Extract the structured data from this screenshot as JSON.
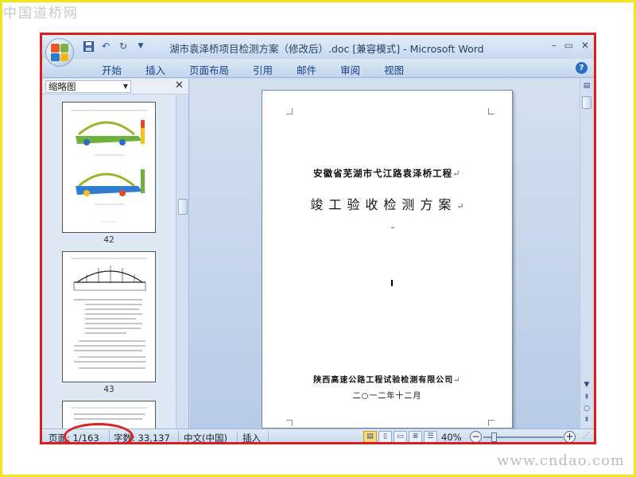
{
  "watermarks": {
    "top_left": "中国道桥网",
    "bottom_right": "www.cndao.com"
  },
  "window": {
    "title": "湖市袁泽桥项目检测方案（修改后）.doc [兼容模式] - Microsoft Word",
    "controls": {
      "minimize": "–",
      "restore": "▭",
      "close": "✕"
    }
  },
  "ribbon": {
    "tabs": [
      "开始",
      "插入",
      "页面布局",
      "引用",
      "邮件",
      "审阅",
      "视图"
    ],
    "help": "?"
  },
  "nav_pane": {
    "view_select": "缩略图",
    "close": "✕",
    "thumbnails": [
      {
        "page": "42"
      },
      {
        "page": "43"
      }
    ]
  },
  "document": {
    "project_title": "安徽省芜湖市弋江路袁泽桥工程",
    "doc_title": "竣工验收检测方案",
    "organization": "陕西高速公路工程试验检测有限公司",
    "date": "二○一二年十二月",
    "para_mark": "↵"
  },
  "status_bar": {
    "page": "页面: 1/163",
    "words": "字数: 33,137",
    "language": "中文(中国)",
    "mode": "插入",
    "zoom": "40%"
  },
  "colors": {
    "highlight_frame": "#d9201e",
    "outer_frame": "#f2e51a",
    "ribbon_text": "#15428b"
  }
}
